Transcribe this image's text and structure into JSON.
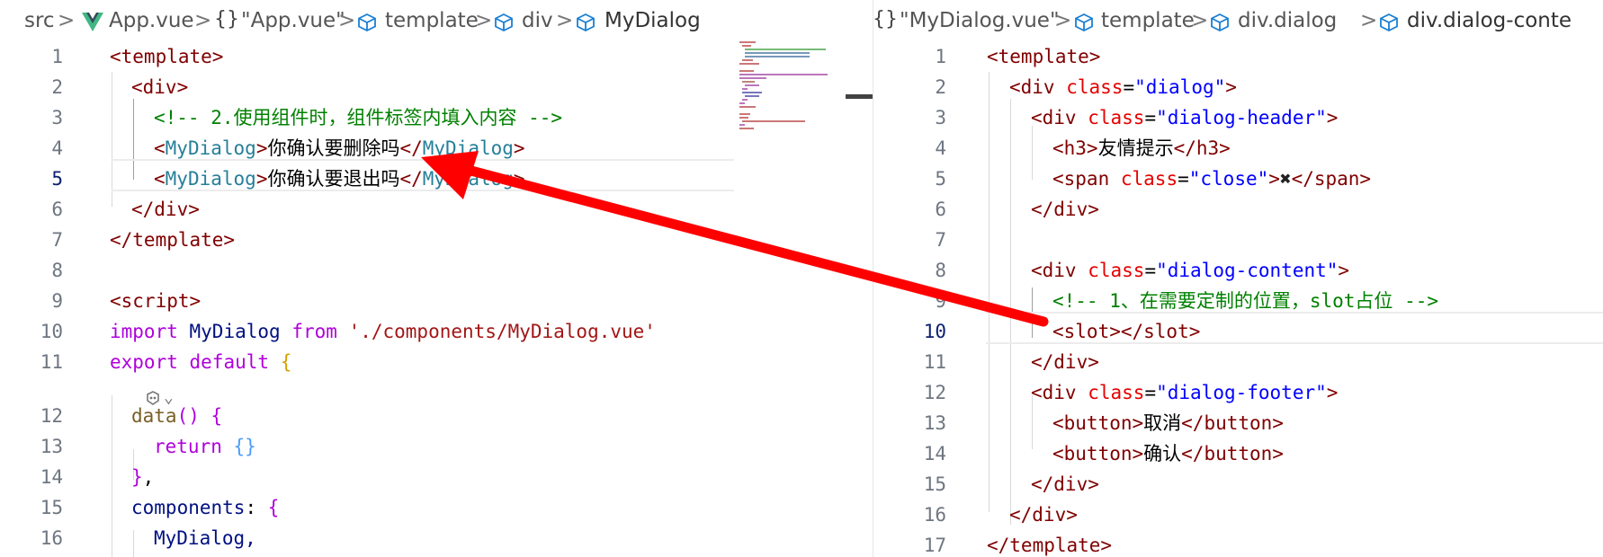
{
  "left_editor": {
    "breadcrumb": {
      "src": "src",
      "file": "App.vue",
      "symbol_file": "\"App.vue\"",
      "template": "template",
      "div": "div",
      "component": "MyDialog"
    },
    "line_numbers": [
      "1",
      "2",
      "3",
      "4",
      "5",
      "6",
      "7",
      "8",
      "9",
      "10",
      "11",
      "12",
      "13",
      "14",
      "15",
      "16"
    ],
    "codelens_icon": "copilot-sparkle-icon",
    "code": {
      "l1_open": "<template>",
      "l2_open": "<div>",
      "l3_comment": "<!-- 2.使用组件时，组件标签内填入内容 -->",
      "l4_lt": "<",
      "l4_tag": "MyDialog",
      "l4_gt": ">",
      "l4_text": "你确认要删除吗",
      "l4_close_lt": "</",
      "l4_close_tag": "MyDialog",
      "l4_close_gt": ">",
      "l5_lt": "<",
      "l5_tag": "MyDialog",
      "l5_gt": ">",
      "l5_text": "你确认要退出吗",
      "l5_close_lt": "</",
      "l5_close_tag": "MyDialog",
      "l5_close_gt": ">",
      "l6_close": "</div>",
      "l7_close": "</template>",
      "l9_script": "<script>",
      "l10_import": "import",
      "l10_name": "MyDialog",
      "l10_from": "from",
      "l10_path": "'./components/MyDialog.vue'",
      "l11_export": "export",
      "l11_default": "default",
      "l11_brace": "{",
      "l12_data": "data",
      "l12_paren": "()",
      "l12_brace": "{",
      "l13_return": "return",
      "l13_obj": "{}",
      "l14_close": "}",
      "l14_comma": ",",
      "l15_key": "components",
      "l15_colon": ":",
      "l15_brace": "{",
      "l16_item": "MyDialog,"
    }
  },
  "right_editor": {
    "breadcrumb": {
      "symbol_file": "\"MyDialog.vue\"",
      "template": "template",
      "div_dialog": "div.dialog",
      "div_content": "div.dialog-conte"
    },
    "line_numbers": [
      "1",
      "2",
      "3",
      "4",
      "5",
      "6",
      "7",
      "8",
      "9",
      "10",
      "11",
      "12",
      "13",
      "14",
      "15",
      "16",
      "17"
    ],
    "close_icon": "heavy-x-icon",
    "code": {
      "l1": "<template>",
      "l2_open": "<div",
      "l2_attr": "class",
      "l2_eq": "=",
      "l2_val": "\"dialog\"",
      "l2_gt": ">",
      "l3_open": "<div",
      "l3_attr": "class",
      "l3_eq": "=",
      "l3_val": "\"dialog-header\"",
      "l3_gt": ">",
      "l4_open": "<h3>",
      "l4_text": "友情提示",
      "l4_close": "</h3>",
      "l5_open": "<span",
      "l5_attr": "class",
      "l5_eq": "=",
      "l5_val": "\"close\"",
      "l5_gt": ">",
      "l5_close": "</span>",
      "l6": "</div>",
      "l8_open": "<div",
      "l8_attr": "class",
      "l8_eq": "=",
      "l8_val": "\"dialog-content\"",
      "l8_gt": ">",
      "l9_comment": "<!-- 1、在需要定制的位置，slot占位 -->",
      "l10": "<slot></slot>",
      "l11": "</div>",
      "l12_open": "<div",
      "l12_attr": "class",
      "l12_eq": "=",
      "l12_val": "\"dialog-footer\"",
      "l12_gt": ">",
      "l13_open": "<button>",
      "l13_text": "取消",
      "l13_close": "</button>",
      "l14_open": "<button>",
      "l14_text": "确认",
      "l14_close": "</button>",
      "l15": "</div>",
      "l16": "</div>",
      "l17": "</template>"
    }
  },
  "annotation": {
    "arrow_color": "#ff0000"
  }
}
